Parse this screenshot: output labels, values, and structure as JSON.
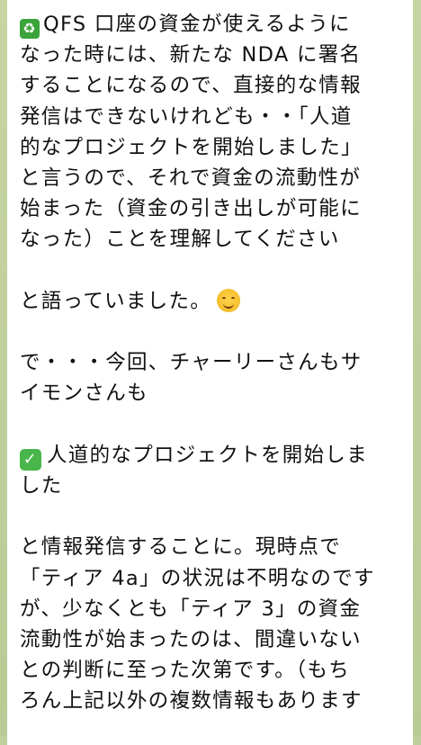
{
  "message": {
    "paragraph1_lines": [
      "QFS 口座の資金が使えるように",
      "なった時には、新たな NDA に署名",
      "することになるので、直接的な情報",
      "発信はできないけれども・・「人道",
      "的なプロジェクトを開始しました」",
      "と言うので、それで資金の流動性が",
      "始まった（資金の引き出しが可能に",
      "なった）ことを理解してください"
    ],
    "paragraph2": "と語っていました。",
    "paragraph3_lines": [
      "で・・・今回、チャーリーさんもサ",
      "イモンさんも"
    ],
    "paragraph4_lines": [
      "人道的なプロジェクトを開始しま",
      "した"
    ],
    "paragraph5_lines": [
      "と情報発信することに。現時点で",
      "「ティア 4a」の状況は不明なのです",
      "が、少なくとも「ティア 3」の資金",
      "流動性が始まったのは、間違いない",
      "との判断に至った次第です。（もち",
      "ろん上記以外の複数情報もあります"
    ],
    "icons": {
      "recycle": "recycle-icon",
      "smile": "smiling-face-icon",
      "check": "check-mark-button-icon"
    },
    "colors": {
      "chat_background": "#bfcf9e",
      "bubble": "#ffffff",
      "text": "#111111"
    }
  }
}
